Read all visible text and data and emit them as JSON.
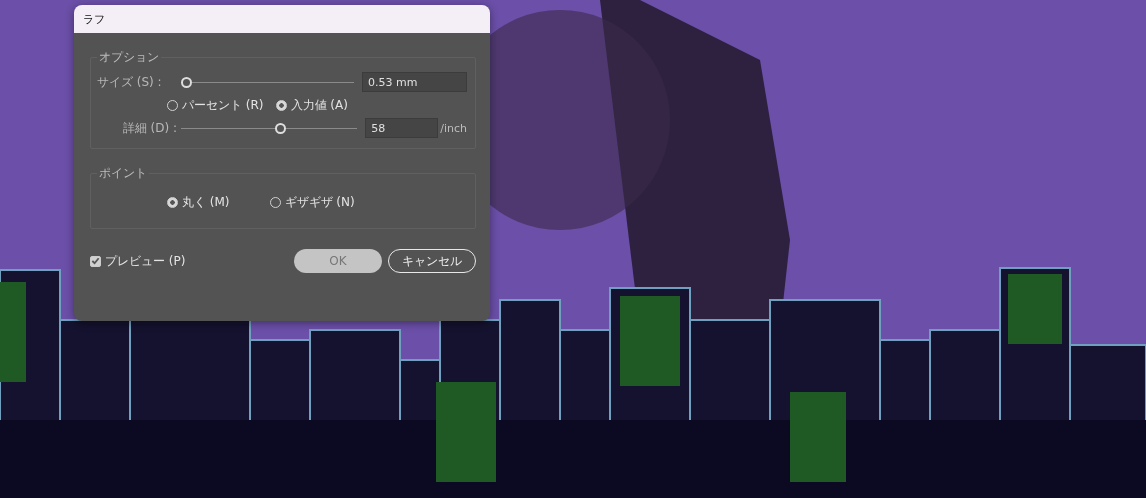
{
  "dialog": {
    "title": "ラフ",
    "options": {
      "heading": "オプション",
      "size": {
        "label": "サイズ (S) :",
        "level": 0.0,
        "value": "0.53 mm"
      },
      "mode_radios": [
        {
          "label": "パーセント (R)",
          "selected": false
        },
        {
          "label": "入力値 (A)",
          "selected": true
        }
      ],
      "detail": {
        "label": "詳細 (D) :",
        "level": 0.57,
        "value": "58",
        "unit": "/inch"
      }
    },
    "points": {
      "heading": "ポイント",
      "radios": [
        {
          "label": "丸く (M)",
          "selected": true
        },
        {
          "label": "ギザギザ (N)",
          "selected": false
        }
      ]
    },
    "preview": {
      "label": "プレビュー (P)",
      "checked": true
    },
    "buttons": [
      {
        "label": "OK",
        "kind": "primary"
      },
      {
        "label": "キャンセル",
        "kind": "secondary"
      }
    ]
  }
}
